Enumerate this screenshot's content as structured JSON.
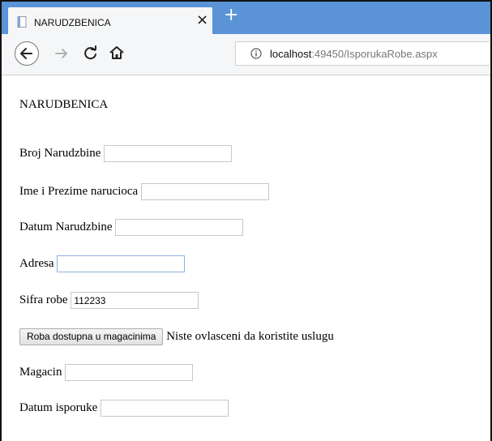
{
  "browser": {
    "tab_title": "NARUDZBENICA",
    "tab_close": "×",
    "new_tab": "+",
    "url_host": "localhost",
    "url_rest": ":49450/IsporukaRobe.aspx"
  },
  "form": {
    "heading": "NARUDBENICA",
    "broj_label": "Broj Narudzbine",
    "broj_value": "",
    "ime_label": "Ime i Prezime narucioca",
    "ime_value": "",
    "datum_label": "Datum Narudzbine",
    "datum_value": "",
    "adresa_label": "Adresa",
    "adresa_value": "",
    "sifra_label": "Sifra robe",
    "sifra_value": "112233",
    "button_label": "Roba dostupna u magacinima",
    "message": "Niste ovlasceni da koristite uslugu",
    "magacin_label": "Magacin",
    "magacin_value": "",
    "isporuka_label": "Datum isporuke",
    "isporuka_value": ""
  }
}
